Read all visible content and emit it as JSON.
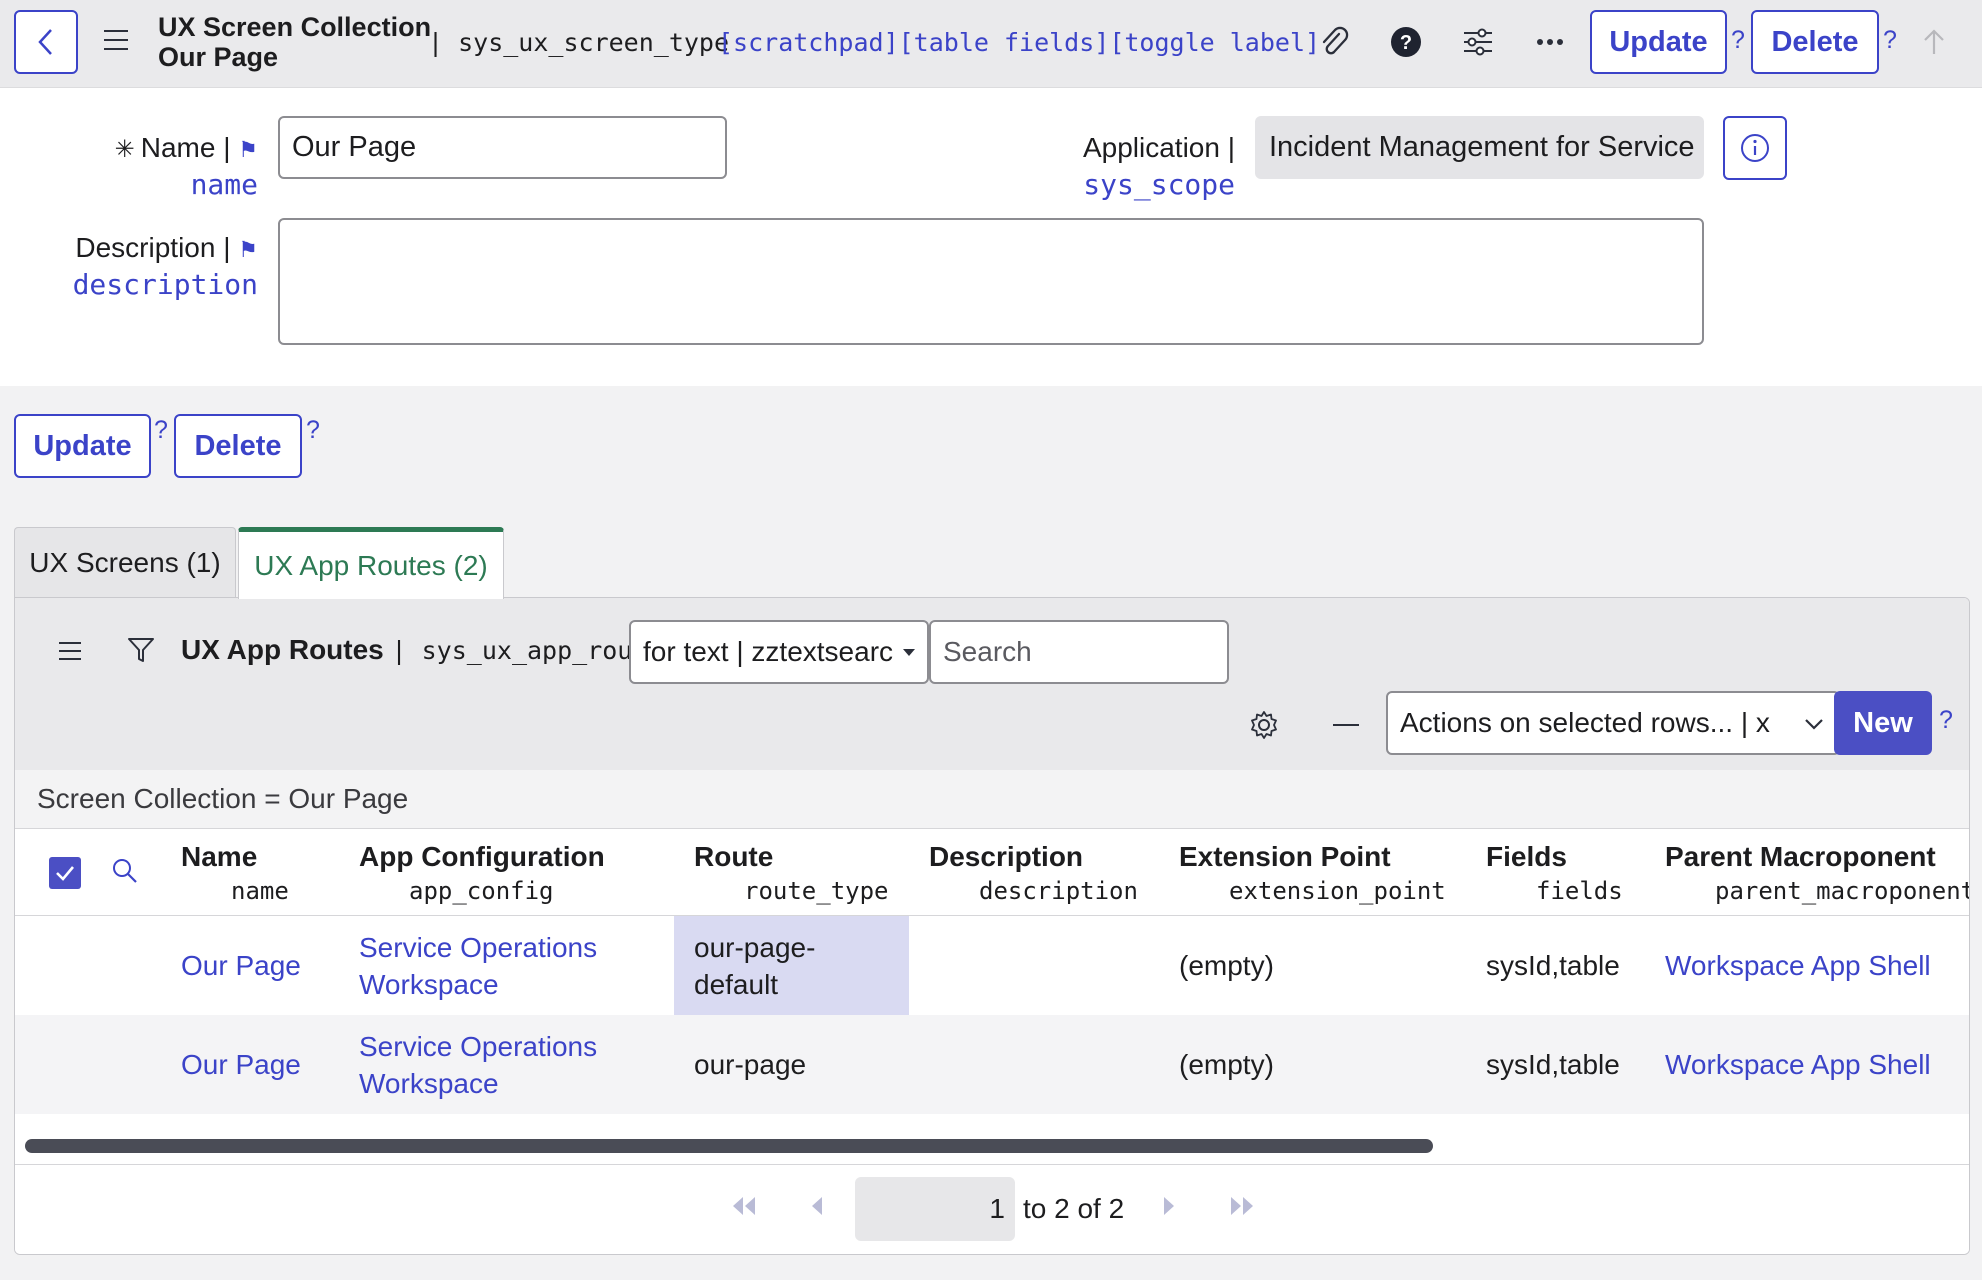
{
  "header": {
    "title_line1": "UX Screen Collection",
    "title_line2": "Our Page",
    "table_name": "| sys_ux_screen_type",
    "links": "[scratchpad][table fields][toggle label]",
    "update_label": "Update",
    "delete_label": "Delete",
    "help_mark": "?"
  },
  "form": {
    "name_label": "Name |",
    "name_field": "name",
    "name_value": "Our Page",
    "description_label": "Description |",
    "description_field": "description",
    "description_value": "",
    "application_label": "Application |",
    "application_field": "sys_scope",
    "application_value": "Incident Management for Service C",
    "required_mark": "✳",
    "flag": "⚑"
  },
  "actions": {
    "update_label": "Update",
    "delete_label": "Delete",
    "help_mark": "?"
  },
  "tabs": [
    {
      "label": "UX Screens (1)",
      "active": false
    },
    {
      "label": "UX App Routes (2)",
      "active": true
    }
  ],
  "list": {
    "title": "UX App Routes",
    "table_name": "| sys_ux_app_route",
    "search_field_select": "for text | zztextsearc",
    "search_placeholder": "Search",
    "actions_select": "Actions on selected rows... | x",
    "new_label": "New",
    "help_mark": "?",
    "breadcrumb": "Screen Collection = Our Page",
    "columns": [
      {
        "label": "Name",
        "field": "name"
      },
      {
        "label": "App Configuration",
        "field": "app_config"
      },
      {
        "label": "Route",
        "field": "route_type"
      },
      {
        "label": "Description",
        "field": "description"
      },
      {
        "label": "Extension Point",
        "field": "extension_point"
      },
      {
        "label": "Fields",
        "field": "fields"
      },
      {
        "label": "Parent Macroponent",
        "field": "parent_macroponent"
      }
    ],
    "rows": [
      {
        "name": "Our Page",
        "app_config_1": "Service Operations",
        "app_config_2": "Workspace",
        "route_1": "our-page-",
        "route_2": "default",
        "description": "",
        "extension_point": "(empty)",
        "fields": "sysId,table",
        "parent": "Workspace App Shell"
      },
      {
        "name": "Our Page",
        "app_config_1": "Service Operations",
        "app_config_2": "Workspace",
        "route_1": "our-page",
        "route_2": "",
        "description": "",
        "extension_point": "(empty)",
        "fields": "sysId,table",
        "parent": "Workspace App Shell"
      }
    ],
    "pager": {
      "current": "1",
      "range_text": "to 2 of 2"
    }
  },
  "colors": {
    "accent": "#3b43c8",
    "tab_active": "#2d7a54",
    "new_button": "#4b4fc4",
    "selected_cell": "#d9daf2"
  }
}
